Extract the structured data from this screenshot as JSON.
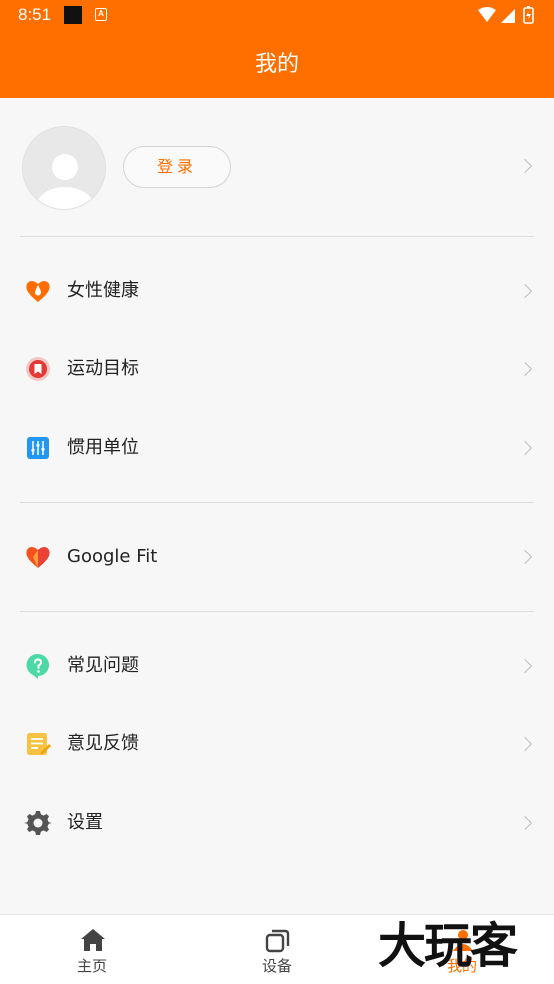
{
  "status_bar": {
    "time": "8:51"
  },
  "header": {
    "title": "我的"
  },
  "profile": {
    "login_label": "登录"
  },
  "menu_groups": [
    [
      {
        "label": "女性健康",
        "icon": "heart-drop-icon",
        "color": "#ff6d00"
      },
      {
        "label": "运动目标",
        "icon": "target-bookmark-icon",
        "color": "#e53935"
      },
      {
        "label": "惯用单位",
        "icon": "sliders-icon",
        "color": "#2196f3"
      }
    ],
    [
      {
        "label": "Google Fit",
        "icon": "google-fit-heart-icon",
        "color": "#ea4335"
      }
    ],
    [
      {
        "label": "常见问题",
        "icon": "question-bubble-icon",
        "color": "#4dd9a6"
      },
      {
        "label": "意见反馈",
        "icon": "feedback-note-icon",
        "color": "#f5c242"
      },
      {
        "label": "设置",
        "icon": "gear-icon",
        "color": "#555555"
      }
    ]
  ],
  "tabbar": {
    "tabs": [
      {
        "label": "主页",
        "icon": "home-icon"
      },
      {
        "label": "设备",
        "icon": "devices-icon"
      },
      {
        "label": "我的",
        "icon": "profile-icon",
        "active": true
      }
    ]
  },
  "watermark": {
    "text": "大玩客"
  },
  "colors": {
    "accent": "#ff6f00",
    "background": "#f7f7f7"
  }
}
